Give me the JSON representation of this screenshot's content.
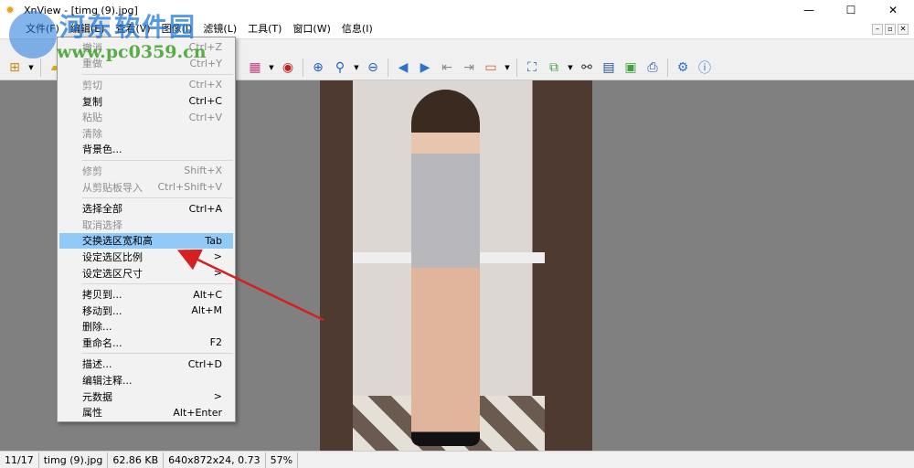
{
  "window": {
    "title": "XnView - [timg (9).jpg]",
    "minimize": "—",
    "maximize": "☐",
    "close": "✕"
  },
  "menubar": {
    "items": [
      "文件(F)",
      "编辑(E)",
      "查看(V)",
      "图像(I)",
      "滤镜(L)",
      "工具(T)",
      "窗口(W)",
      "信息(I)"
    ],
    "mdi": [
      "–",
      "▫",
      "✕"
    ]
  },
  "toolbar": {
    "icons": [
      "browser-icon",
      "open-folder-icon",
      "color-palette-icon",
      "red-eye-icon",
      "zoom-in-icon",
      "zoom-fit-icon",
      "zoom-out-icon",
      "prev-icon",
      "next-icon",
      "first-icon",
      "last-icon",
      "slideshow-icon",
      "fullscreen-icon",
      "convert-icon",
      "find-icon",
      "scan-icon",
      "capture-icon",
      "print-icon",
      "settings-icon",
      "info-icon"
    ]
  },
  "edit_menu": {
    "items": [
      {
        "label": "撤消",
        "shortcut": "Ctrl+Z",
        "disabled": true
      },
      {
        "label": "重做",
        "shortcut": "Ctrl+Y",
        "disabled": true
      },
      {
        "sep": true
      },
      {
        "label": "剪切",
        "shortcut": "Ctrl+X",
        "disabled": true
      },
      {
        "label": "复制",
        "shortcut": "Ctrl+C"
      },
      {
        "label": "粘贴",
        "shortcut": "Ctrl+V",
        "disabled": true
      },
      {
        "label": "清除",
        "shortcut": "",
        "disabled": true
      },
      {
        "label": "背景色...",
        "shortcut": ""
      },
      {
        "sep": true
      },
      {
        "label": "修剪",
        "shortcut": "Shift+X",
        "disabled": true
      },
      {
        "label": "从剪贴板导入",
        "shortcut": "Ctrl+Shift+V",
        "disabled": true
      },
      {
        "sep": true
      },
      {
        "label": "选择全部",
        "shortcut": "Ctrl+A"
      },
      {
        "label": "取消选择",
        "shortcut": "",
        "disabled": true
      },
      {
        "label": "交换选区宽和高",
        "shortcut": "Tab",
        "highlighted": true
      },
      {
        "label": "设定选区比例",
        "shortcut": ">"
      },
      {
        "label": "设定选区尺寸",
        "shortcut": ">"
      },
      {
        "sep": true
      },
      {
        "label": "拷贝到...",
        "shortcut": "Alt+C"
      },
      {
        "label": "移动到...",
        "shortcut": "Alt+M"
      },
      {
        "label": "删除...",
        "shortcut": ""
      },
      {
        "label": "重命名...",
        "shortcut": "F2"
      },
      {
        "sep": true
      },
      {
        "label": "描述...",
        "shortcut": "Ctrl+D"
      },
      {
        "label": "编辑注释...",
        "shortcut": ""
      },
      {
        "label": "元数据",
        "shortcut": ">"
      },
      {
        "label": "属性",
        "shortcut": "Alt+Enter"
      }
    ]
  },
  "statusbar": {
    "index": "11/17",
    "filename": "timg (9).jpg",
    "size": "62.86 KB",
    "info": "640x872x24, 0.73",
    "zoom": "57%"
  },
  "watermark": {
    "name": "河东软件园",
    "url": "www.pc0359.cn"
  },
  "colors": {
    "highlight": "#91c9f7",
    "canvas": "#808080",
    "arrow": "#d42020"
  }
}
